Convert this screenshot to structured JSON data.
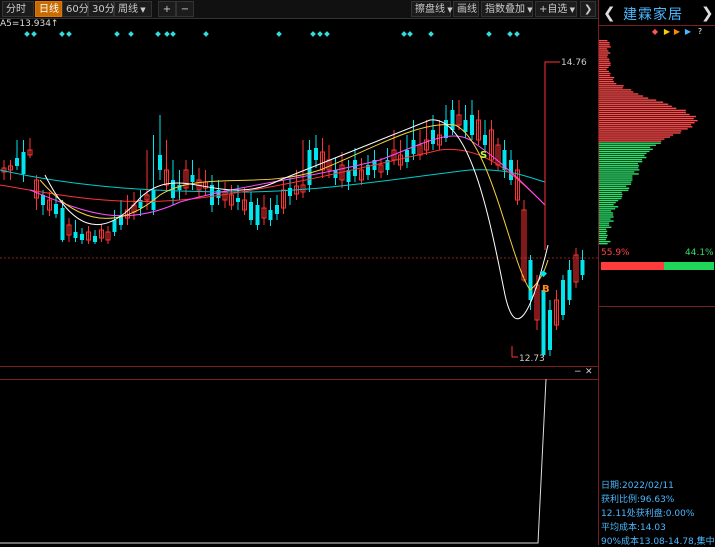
{
  "toolbar": {
    "fenshi": "分时",
    "rixian": "日线",
    "min60": "60分",
    "min30": "30分",
    "zhouxian": "周线",
    "add": "+",
    "minus": "−",
    "woqu": "擦盘线",
    "huaxian": "画线",
    "zhishu": "指数叠加",
    "zixuan": "+自选",
    "collapse": "❯"
  },
  "main_chart": {
    "ma_text": "A5=13.934↑",
    "high_label": "14.76",
    "low_label": "12.73",
    "buy_marker": "B",
    "sell_marker": "S",
    "colors": {
      "up": "#ff3333",
      "down": "#00e5ee",
      "ma5": "#ffffff",
      "ma10": "#f5d23b",
      "ma20": "#ff4fff",
      "ma30": "#ff3333",
      "ma60": "#00cccc"
    }
  },
  "sub_pane": {
    "minimize": "−",
    "close": "✕"
  },
  "right_panel": {
    "left_arrow": "❮",
    "stock_name": "建霖家居",
    "right_arrow": "❯",
    "profit_pct": "55.9%",
    "loss_pct": "44.1%",
    "date": "日期:2022/02/11",
    "profit_ratio": "获利比例:96.63%",
    "profit_at": "12.11处获利盘:0.00%",
    "avg_cost": "平均成本:14.03",
    "cost_90": "90%成本13.08-14.78,集中"
  }
}
